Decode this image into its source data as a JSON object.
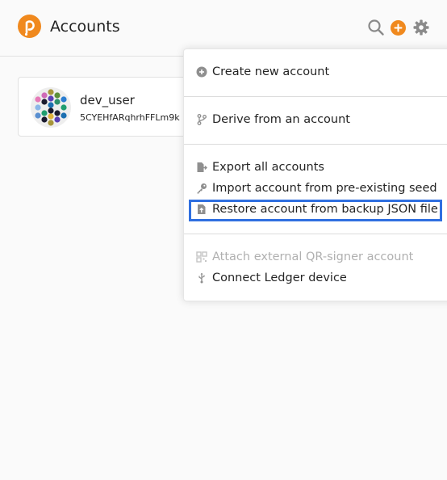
{
  "header": {
    "title": "Accounts"
  },
  "account": {
    "name": "dev_user",
    "address": "5CYEHfARqhrhFFLm9k"
  },
  "menu": {
    "create": "Create new account",
    "derive": "Derive from an account",
    "export_all": "Export all accounts",
    "import_seed": "Import account from pre-existing seed",
    "restore_json": "Restore account from backup JSON file",
    "attach_qr": "Attach external QR-signer account",
    "connect_ledger": "Connect Ledger device"
  },
  "colors": {
    "brand": "#f0891e",
    "highlight": "#2f6fe0",
    "disabled": "#b0b0b0"
  }
}
